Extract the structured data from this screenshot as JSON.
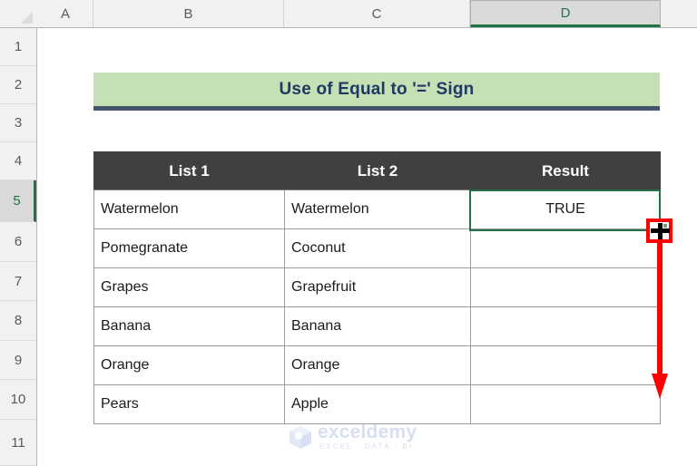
{
  "spreadsheet": {
    "column_headers": [
      "A",
      "B",
      "C",
      "D"
    ],
    "selected_column": "D",
    "row_headers": [
      "1",
      "2",
      "3",
      "4",
      "5",
      "6",
      "7",
      "8",
      "9",
      "10",
      "11"
    ],
    "selected_row": "5",
    "active_cell_value": "TRUE"
  },
  "title_banner": {
    "text": "Use of Equal to '=' Sign",
    "fill_color": "#C5E0B4",
    "text_color": "#1F3864",
    "border_color": "#44546A"
  },
  "table": {
    "headers": [
      "List 1",
      "List 2",
      "Result"
    ],
    "header_bg": "#404040",
    "header_color": "#FFFFFF",
    "rows": [
      {
        "list1": "Watermelon",
        "list2": "Watermelon",
        "result": "TRUE"
      },
      {
        "list1": "Pomegranate",
        "list2": "Coconut",
        "result": ""
      },
      {
        "list1": "Grapes",
        "list2": "Grapefruit",
        "result": ""
      },
      {
        "list1": "Banana",
        "list2": "Banana",
        "result": ""
      },
      {
        "list1": "Orange",
        "list2": "Orange",
        "result": ""
      },
      {
        "list1": "Pears",
        "list2": "Apple",
        "result": ""
      }
    ]
  },
  "annotations": {
    "fill_handle_cursor": "fill-handle-crosshair-cursor",
    "arrow_color": "#FF0000",
    "highlight_color": "#FF0000",
    "selection_color": "#217346"
  },
  "watermark": {
    "name": "exceldemy",
    "tagline": "EXCEL - DATA - BI"
  }
}
